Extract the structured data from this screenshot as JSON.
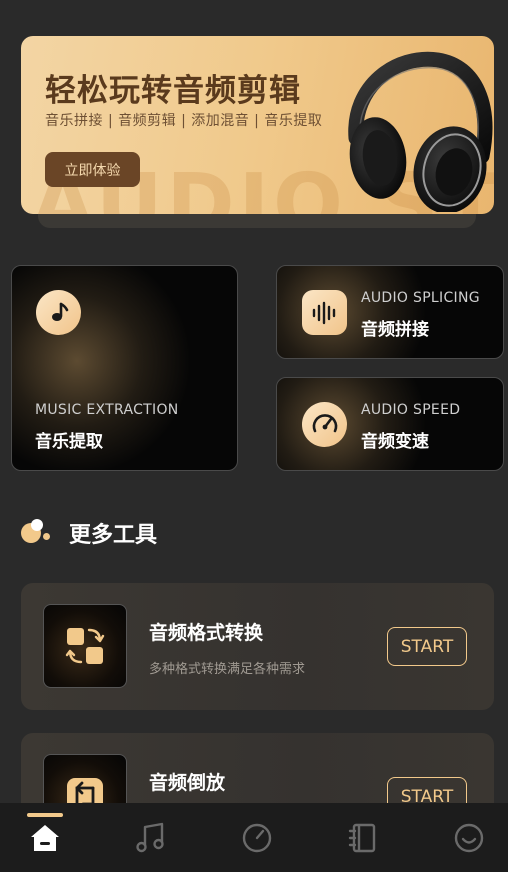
{
  "banner": {
    "title": "轻松玩转音频剪辑",
    "subtitle": "音乐拼接 | 音频剪辑 | 添加混音 | 音乐提取",
    "button_label": "立即体验",
    "watermark": "AUDIO STUDIO"
  },
  "features": {
    "music_extraction": {
      "en": "MUSIC EXTRACTION",
      "cn": "音乐提取",
      "icon": "music-note-icon"
    },
    "audio_splicing": {
      "en": "AUDIO SPLICING",
      "cn": "音频拼接",
      "icon": "waveform-icon"
    },
    "audio_speed": {
      "en": "AUDIO SPEED",
      "cn": "音频变速",
      "icon": "speedometer-icon"
    }
  },
  "section": {
    "title": "更多工具"
  },
  "tools": [
    {
      "title": "音频格式转换",
      "description": "多种格式转换满足各种需求",
      "button": "START",
      "icon": "format-convert-icon"
    },
    {
      "title": "音频倒放",
      "description": "",
      "button": "START",
      "icon": "reverse-icon"
    }
  ],
  "nav": {
    "items": [
      "home-icon",
      "music-icon",
      "gauge-icon",
      "notebook-icon",
      "smile-icon"
    ],
    "active": "home-icon"
  },
  "colors": {
    "accent": "#f2c98b",
    "background": "#2a2a2a",
    "card": "#060606",
    "nav": "#1c1c1c"
  }
}
